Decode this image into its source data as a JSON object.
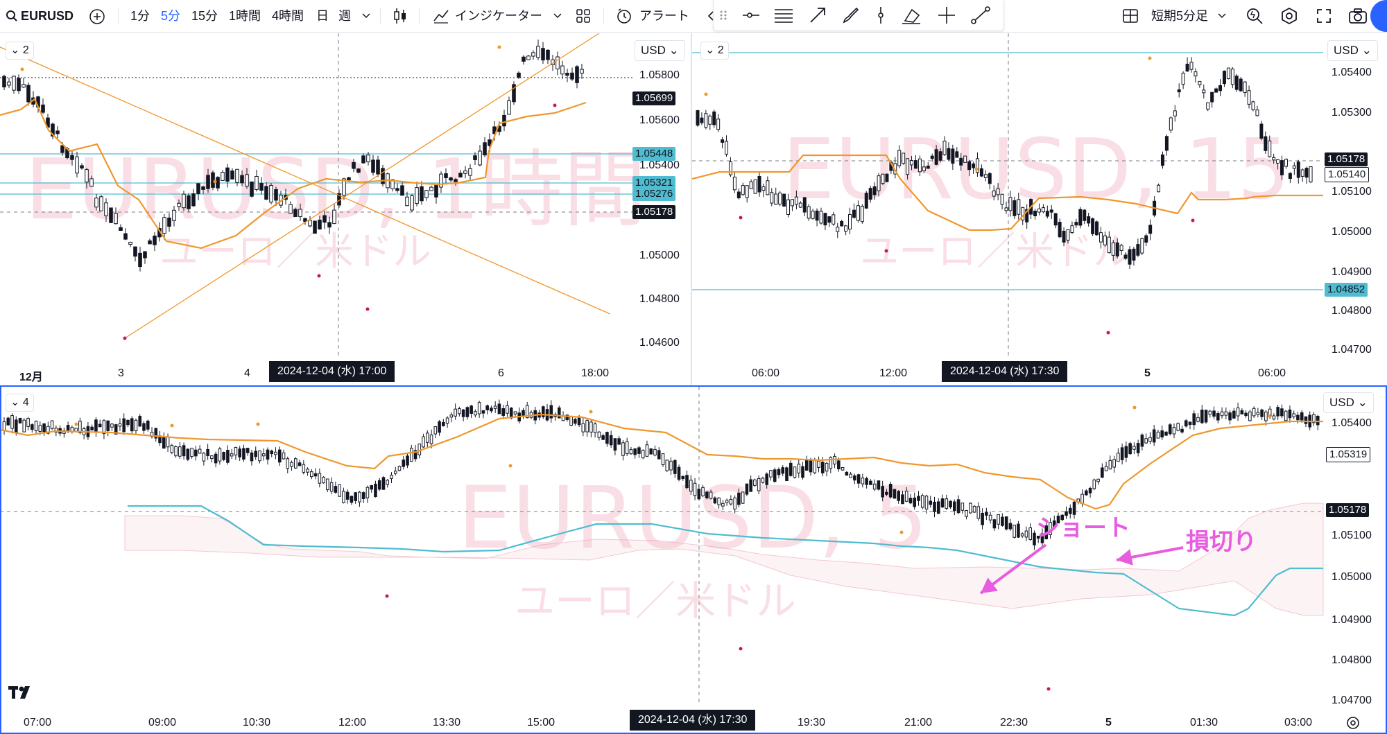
{
  "toolbar": {
    "symbol": "EURUSD",
    "intervals": [
      "1分",
      "5分",
      "15分",
      "1時間",
      "4時間",
      "日",
      "週"
    ],
    "active_interval": "5分",
    "indicators_label": "インジケーター",
    "alert_label": "アラート",
    "layout_name": "短期5分足"
  },
  "chart_panes": [
    {
      "id": "top-left",
      "watermark_symbol": "EURUSD, 1時間",
      "watermark_desc": "ユーロ／米ドル",
      "currency": "USD",
      "collapse_count": "2",
      "price_ticks": [
        "1.05800",
        "1.05600",
        "1.05400",
        "1.05200",
        "1.05000",
        "1.04800",
        "1.04600"
      ],
      "time_ticks": [
        "12月",
        "3",
        "4",
        "6",
        "18:00"
      ],
      "crosshair_time": "2024-12-04 (水)   17:00",
      "price_tags": [
        "1.05699",
        "1.05448",
        "1.05321",
        "1.05276",
        "1.05178"
      ]
    },
    {
      "id": "top-right",
      "watermark_symbol": "EURUSD, 15",
      "watermark_desc": "ユーロ／米ドル",
      "currency": "USD",
      "collapse_count": "2",
      "price_ticks": [
        "1.05400",
        "1.05300",
        "1.05200",
        "1.05100",
        "1.05000",
        "1.04900",
        "1.04800",
        "1.04700"
      ],
      "time_ticks": [
        "06:00",
        "12:00",
        "5",
        "06:00"
      ],
      "crosshair_time": "2024-12-04 (水)   17:30",
      "price_tags": [
        "1.05178",
        "1.05140",
        "1.04852"
      ]
    },
    {
      "id": "bottom",
      "watermark_symbol": "EURUSD, 5",
      "watermark_desc": "ユーロ／米ドル",
      "currency": "USD",
      "collapse_count": "4",
      "price_ticks": [
        "1.05400",
        "1.05300",
        "1.05200",
        "1.05100",
        "1.05000",
        "1.04900",
        "1.04800",
        "1.04700"
      ],
      "time_ticks": [
        "07:00",
        "09:00",
        "10:30",
        "12:00",
        "13:30",
        "15:00",
        "19:30",
        "21:00",
        "22:30",
        "5",
        "01:30",
        "03:00"
      ],
      "crosshair_time": "2024-12-04 (水)   17:30",
      "price_tags": [
        "1.05319",
        "1.05178"
      ],
      "annotations": [
        "ショート",
        "損切り"
      ]
    }
  ],
  "colors": {
    "up": "#ffffff",
    "down": "#000000",
    "ma": "#f0972c",
    "hline": "#4fbcd0",
    "annotation": "#e85ce0",
    "accent": "#2962ff"
  },
  "icons": [
    "search-icon",
    "add-symbol-icon",
    "bar-style-icon",
    "indicators-icon",
    "layouts-icon",
    "alert-icon",
    "layout-icon",
    "settings-icon",
    "fullscreen-icon",
    "camera-icon",
    "tradingview-logo"
  ]
}
